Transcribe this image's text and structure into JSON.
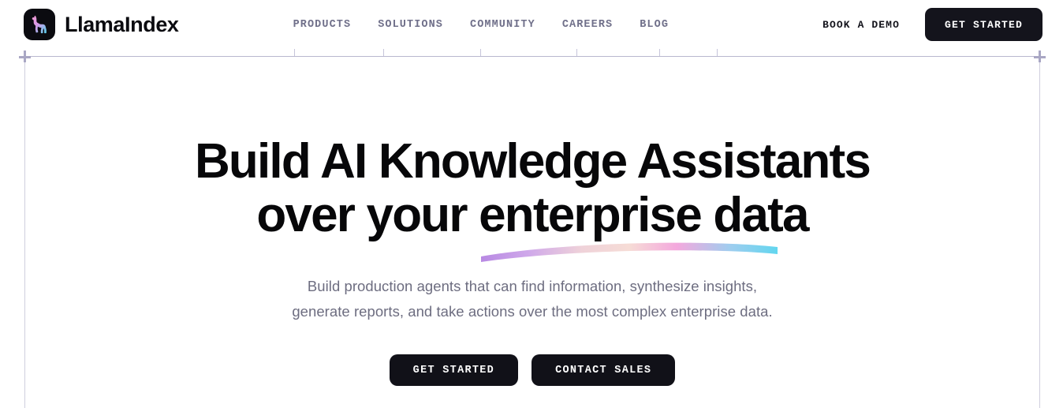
{
  "brand": {
    "name": "LlamaIndex",
    "logo_icon": "llama-logo-icon",
    "logo_bg": "#0b0b10",
    "logo_gradient_from": "#f49ad0",
    "logo_gradient_to": "#5fd2ee"
  },
  "nav": {
    "links": [
      {
        "label": "PRODUCTS"
      },
      {
        "label": "SOLUTIONS"
      },
      {
        "label": "COMMUNITY"
      },
      {
        "label": "CAREERS"
      },
      {
        "label": "BLOG"
      }
    ],
    "demo_label": "BOOK A DEMO",
    "cta_label": "GET STARTED",
    "link_color": "#70708a",
    "cta_bg": "#14141c"
  },
  "hero": {
    "headline_line1": "Build AI Knowledge Assistants",
    "headline_line2": "over your enterprise data",
    "subtitle_line1": "Build production agents that can find information, synthesize insights,",
    "subtitle_line2": "generate reports, and take actions over the most complex enterprise data.",
    "primary_cta": "GET STARTED",
    "secondary_cta": "CONTACT SALES",
    "headline_color": "#070709",
    "subtitle_color": "#6d6d80",
    "swoosh": {
      "icon": "gradient-underline-swoosh-icon",
      "stop_0": "#b889e3",
      "stop_1": "#d9b6ec",
      "stop_2": "#f6dcd6",
      "stop_3": "#f4a8dd",
      "stop_4": "#8ec9ef",
      "stop_5": "#62d6ef"
    }
  },
  "decoration": {
    "rule_color": "#b9b8cf",
    "guide_color": "#cfcede",
    "cross_color": "#a9a7c4",
    "cross_icon": "plus-crosshair-icon",
    "tick_positions": [
      373,
      486,
      609,
      731,
      836,
      909
    ]
  }
}
